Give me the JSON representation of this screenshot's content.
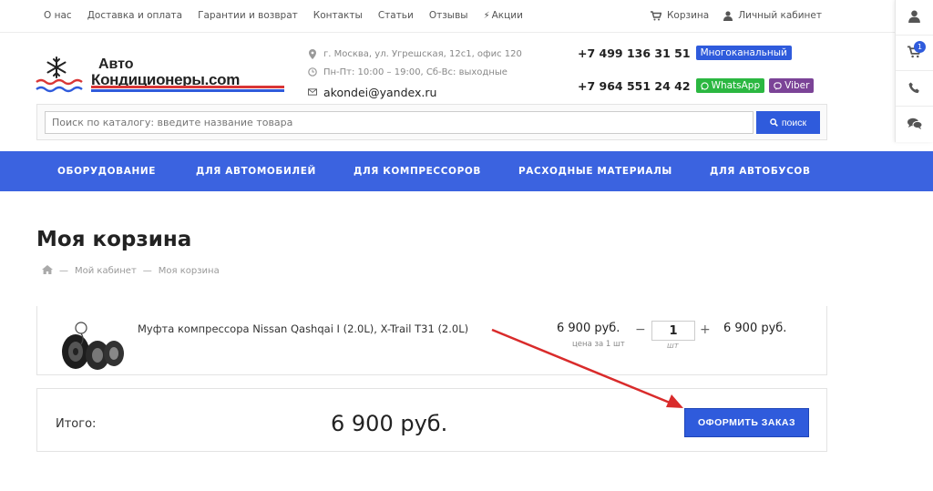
{
  "topnav": {
    "items": [
      "О нас",
      "Доставка и оплата",
      "Гарантии и возврат",
      "Контакты",
      "Статьи",
      "Отзывы"
    ],
    "promo": "Акции",
    "cart": "Корзина",
    "account": "Личный кабинет"
  },
  "sidebar": {
    "cart_count": "1"
  },
  "logo": {
    "line1": "Авто",
    "line2": "Кондиционеры.com"
  },
  "contacts": {
    "address": "г. Москва, ул. Угрешская, 12с1, офис 120",
    "hours": "Пн-Пт: 10:00 – 19:00, Сб-Вс: выходные",
    "email": "akondei@yandex.ru"
  },
  "phones": {
    "phone1": "+7 499 136 31 51",
    "phone1_tag": "Многоканальный",
    "phone2": "+7 964 551 24 42",
    "whatsapp": "WhatsApp",
    "viber": "Viber"
  },
  "search": {
    "placeholder": "Поиск по каталогу: введите название товара",
    "button": "поиск"
  },
  "mainnav": [
    "ОБОРУДОВАНИЕ",
    "ДЛЯ АВТОМОБИЛЕЙ",
    "ДЛЯ КОМПРЕССОРОВ",
    "РАСХОДНЫЕ МАТЕРИАЛЫ",
    "ДЛЯ АВТОБУСОВ"
  ],
  "page": {
    "title": "Моя корзина",
    "breadcrumb": [
      "Мой кабинет",
      "Моя корзина"
    ],
    "breadcrumb_sep": "—"
  },
  "cart": {
    "item": {
      "name": "Муфта компрессора Nissan Qashqai I (2.0L), X-Trail T31 (2.0L)",
      "price": "6 900 руб.",
      "price_note": "цена за 1 шт",
      "qty": "1",
      "unit": "шт",
      "line_total": "6 900 руб."
    },
    "total_label": "Итого:",
    "total_value": "6 900 руб.",
    "checkout": "ОФОРМИТЬ ЗАКАЗ"
  },
  "colors": {
    "accent": "#3b63e0",
    "annotation": "#d92b2b"
  }
}
